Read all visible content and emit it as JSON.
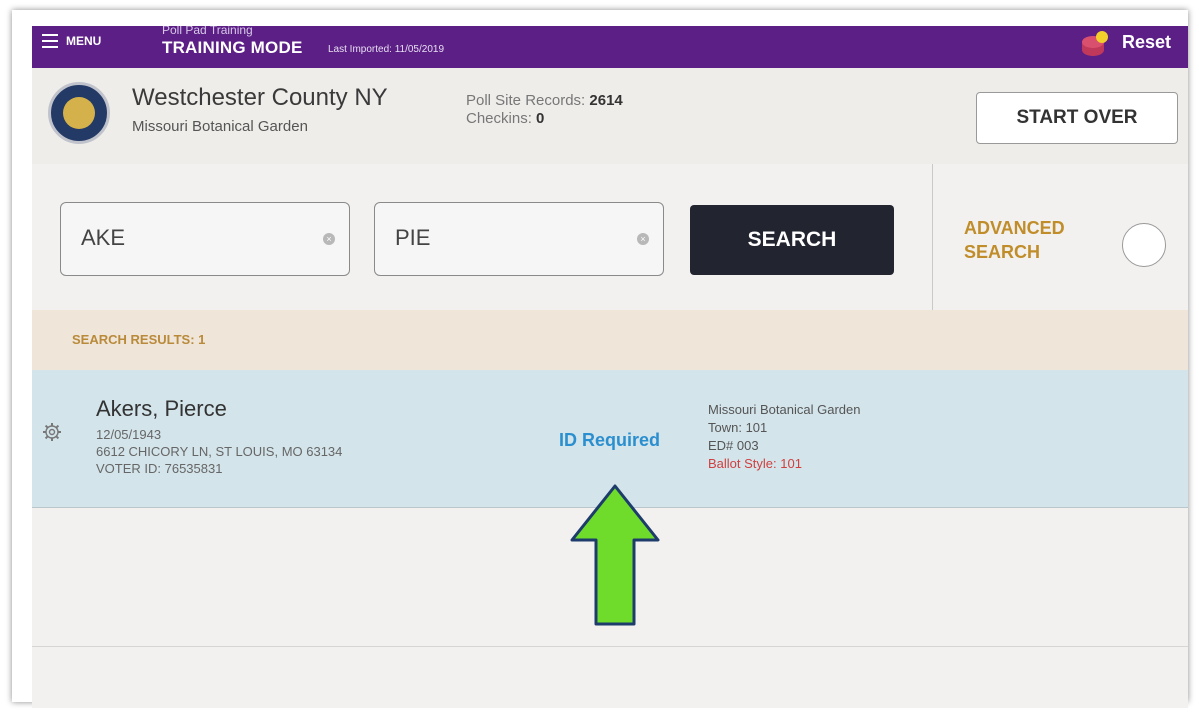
{
  "topbar": {
    "menu_label": "MENU",
    "poll_pad_label": "Poll Pad Training",
    "mode_label": "TRAINING MODE",
    "last_imported": "Last Imported: 11/05/2019",
    "reset_label": "Reset"
  },
  "header": {
    "county": "Westchester County NY",
    "site": "Missouri Botanical Garden",
    "records_label": "Poll Site Records:",
    "records_value": "2614",
    "checkins_label": "Checkins:",
    "checkins_value": "0",
    "start_over_label": "START OVER"
  },
  "search": {
    "last_name": "AKE",
    "first_name": "PIE",
    "search_label": "SEARCH",
    "advanced_line1": "ADVANCED",
    "advanced_line2": "SEARCH"
  },
  "results": {
    "header": "SEARCH RESULTS: 1",
    "items": [
      {
        "name": "Akers, Pierce",
        "dob": "12/05/1943",
        "address": "6612 CHICORY LN, ST LOUIS, MO 63134",
        "voter_id": "VOTER ID: 76535831",
        "status": "ID Required",
        "location": "Missouri Botanical Garden",
        "town": "Town: 101",
        "ed": "ED# 003",
        "ballot_style": "Ballot Style: 101"
      }
    ]
  },
  "colors": {
    "topbar": "#5c1f86",
    "search_button": "#222430",
    "advanced_search": "#c08d2a",
    "results_header": "#b98a3a",
    "id_required": "#2b8fcf",
    "ballot_style": "#d04040",
    "arrow_fill": "#6fdc2c"
  },
  "icons": {
    "menu": "hamburger-icon",
    "reset": "reset-icon",
    "seal": "county-seal-icon",
    "clear": "clear-icon",
    "gear": "gear-icon",
    "arrow": "up-arrow-icon"
  }
}
